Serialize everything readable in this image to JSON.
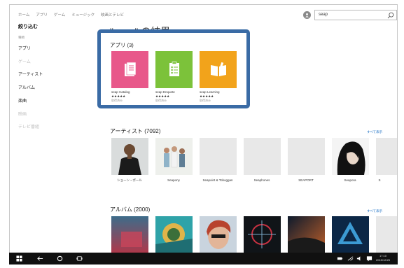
{
  "topnav": [
    "ホーム",
    "アプリ",
    "ゲーム",
    "ミュージック",
    "映画とテレビ"
  ],
  "search": {
    "value": "seap"
  },
  "sidebar": {
    "title": "絞り込む",
    "sub": "種類",
    "items": [
      {
        "label": "アプリ",
        "dim": false
      },
      {
        "label": "ゲーム",
        "dim": true
      },
      {
        "label": "アーティスト",
        "dim": false
      },
      {
        "label": "アルバム",
        "dim": false
      },
      {
        "label": "楽曲",
        "dim": false
      },
      {
        "label": "映画",
        "dim": true
      },
      {
        "label": "テレビ番組",
        "dim": true
      }
    ]
  },
  "main": {
    "title": "\"seap\" の結果"
  },
  "apps": {
    "heading": "アプリ (3)",
    "items": [
      {
        "name": "seap Catalog",
        "stars": "★★★★★",
        "owned": "取得済み",
        "color": "#e8588a"
      },
      {
        "name": "seap Enquete",
        "stars": "★★★★★",
        "owned": "取得済み",
        "color": "#7cc23a"
      },
      {
        "name": "seap Learning",
        "stars": "★★★★★",
        "owned": "取得済み",
        "color": "#f2a31b"
      }
    ]
  },
  "artists": {
    "heading": "アーティスト (7092)",
    "show_all": "すべて表示",
    "items": [
      {
        "name": "ショーン・ポール"
      },
      {
        "name": "Seapony"
      },
      {
        "name": "Seapoint & Toboggan"
      },
      {
        "name": "Seaphones"
      },
      {
        "name": "SEAPORT"
      },
      {
        "name": "Seapora"
      },
      {
        "name": "S"
      }
    ]
  },
  "albums": {
    "heading": "アルバム (2000)",
    "show_all": "すべて表示"
  },
  "taskbar": {
    "time": "17:10",
    "date": "2015/12/25"
  }
}
